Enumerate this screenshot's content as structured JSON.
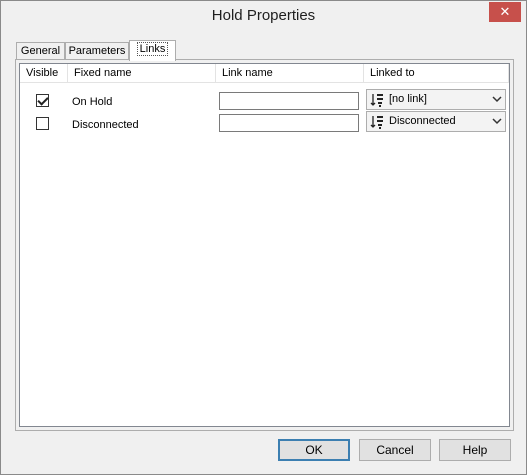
{
  "window": {
    "title": "Hold Properties",
    "close_glyph": "✕"
  },
  "tabs": [
    {
      "label": "General"
    },
    {
      "label": "Parameters"
    },
    {
      "label": "Links"
    }
  ],
  "active_tab": "Links",
  "table": {
    "columns": [
      "Visible",
      "Fixed name",
      "Link name",
      "Linked to"
    ],
    "rows": [
      {
        "visible": true,
        "fixed_name": "On Hold",
        "link_name": "",
        "linked_to": "[no link]"
      },
      {
        "visible": false,
        "fixed_name": "Disconnected",
        "link_name": "",
        "linked_to": "Disconnected"
      }
    ]
  },
  "buttons": {
    "ok": "OK",
    "cancel": "Cancel",
    "help": "Help"
  },
  "icons": {
    "close": "close-icon",
    "link": "link-icon",
    "dropdown": "chevron-down-icon"
  },
  "colors": {
    "close_bg": "#c7504b",
    "default_button_border": "#3c7fb1",
    "window_bg": "#f0f0f0"
  }
}
